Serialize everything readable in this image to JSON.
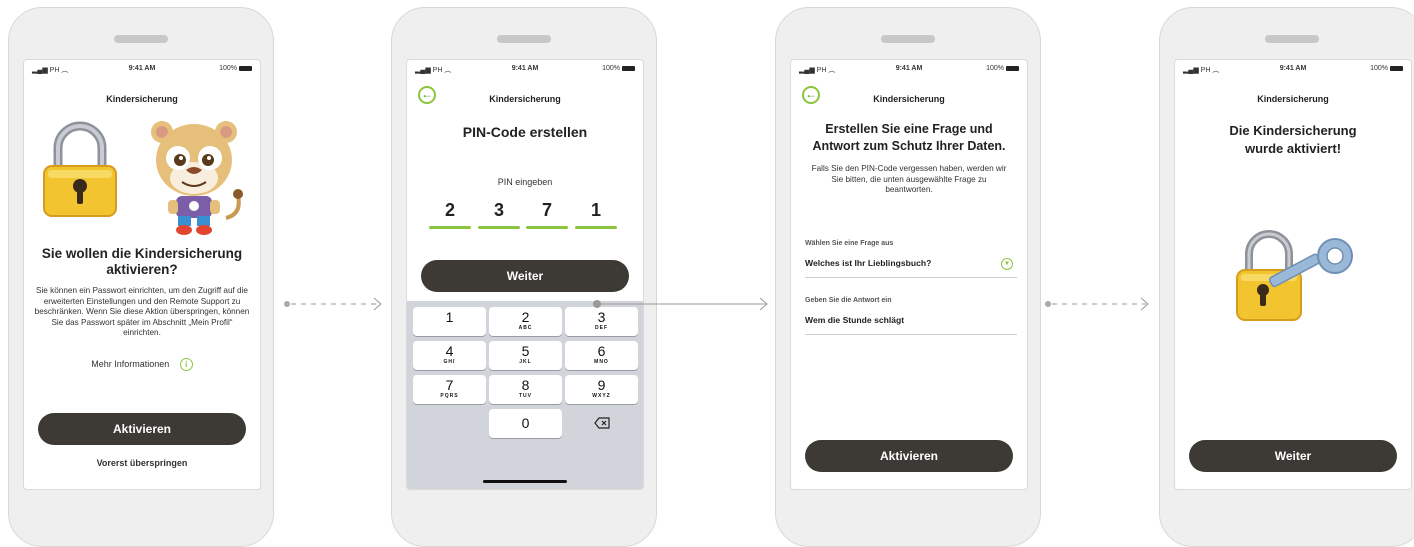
{
  "status_bar": {
    "signal": "PH",
    "time": "9:41 AM",
    "battery": "100%"
  },
  "screens": [
    {
      "nav_title": "Kindersicherung",
      "heading": "Sie wollen die Kindersicherung aktivieren?",
      "body": "Sie können ein Passwort einrichten, um den Zugriff auf die erweiterten Einstellungen und den Remote Support zu beschränken. Wenn Sie diese Aktion überspringen, können Sie das Passwort später im Abschnitt „Mein Profil“ einrichten.",
      "more_info": "Mehr Informationen",
      "primary_button": "Aktivieren",
      "skip_link": "Vorerst überspringen"
    },
    {
      "nav_title": "Kindersicherung",
      "heading": "PIN-Code erstellen",
      "pin_label": "PIN eingeben",
      "pin_digits": [
        "2",
        "3",
        "7",
        "1"
      ],
      "primary_button": "Weiter",
      "keypad": [
        {
          "num": "1",
          "letters": ""
        },
        {
          "num": "2",
          "letters": "ABC"
        },
        {
          "num": "3",
          "letters": "DEF"
        },
        {
          "num": "4",
          "letters": "GHI"
        },
        {
          "num": "5",
          "letters": "JKL"
        },
        {
          "num": "6",
          "letters": "MNO"
        },
        {
          "num": "7",
          "letters": "PQRS"
        },
        {
          "num": "8",
          "letters": "TUV"
        },
        {
          "num": "9",
          "letters": "WXYZ"
        },
        {
          "num": "0",
          "letters": ""
        }
      ]
    },
    {
      "nav_title": "Kindersicherung",
      "heading": "Erstellen Sie eine Frage und Antwort zum Schutz Ihrer Daten.",
      "body": "Falls Sie den PIN-Code vergessen haben, werden wir Sie bitten, die unten ausgewählte Frage zu beantworten.",
      "question_label": "Wählen Sie eine Frage aus",
      "question_value": "Welches ist Ihr Lieblingsbuch?",
      "answer_label": "Geben Sie die Antwort ein",
      "answer_value": "Wem die Stunde schlägt",
      "primary_button": "Aktivieren"
    },
    {
      "nav_title": "Kindersicherung",
      "heading": "Die Kindersicherung wurde aktiviert!",
      "primary_button": "Weiter"
    }
  ],
  "icons": {
    "lock": "padlock-icon",
    "mascot": "lion-mascot",
    "back": "back-arrow-icon",
    "info": "info-icon",
    "dropdown": "chevron-down-icon",
    "delete": "backspace-icon",
    "lock_key": "lock-with-key-icon"
  },
  "colors": {
    "accent": "#8bc53f",
    "button": "#3d3a36",
    "lock": "#f2c530"
  }
}
